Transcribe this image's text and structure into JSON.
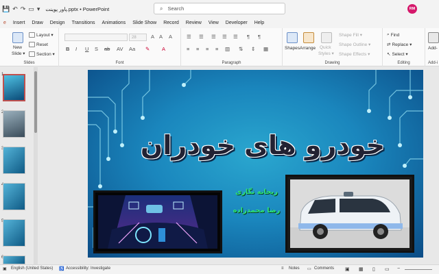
{
  "titlebar": {
    "doc_title": "پاور پوینت.pptx  •  PowerPoint",
    "search_placeholder": "Search",
    "avatar_initials": "RM",
    "qat": [
      "💾",
      "↶",
      "↷",
      "▭",
      "▾"
    ]
  },
  "tabs": [
    "e",
    "Insert",
    "Draw",
    "Design",
    "Transitions",
    "Animations",
    "Slide Show",
    "Record",
    "Review",
    "View",
    "Developer",
    "Help"
  ],
  "ribbon": {
    "slides": {
      "new_slide": "New",
      "new_slide_2": "Slide ▾",
      "layout": "Layout ▾",
      "reset": "Reset",
      "section": "Section ▾",
      "label": "Slides"
    },
    "font": {
      "font_size": "28",
      "label": "Font"
    },
    "paragraph": {
      "label": "Paragraph"
    },
    "drawing": {
      "shapes": "Shapes",
      "arrange": "Arrange",
      "quick_styles": "Quick",
      "quick_styles_2": "Styles ▾",
      "shape_fill": "Shape Fill ▾",
      "shape_outline": "Shape Outline ▾",
      "shape_effects": "Shape Effects ▾",
      "label": "Drawing"
    },
    "editing": {
      "find": "Find",
      "replace": "Replace ▾",
      "select": "Select ▾",
      "label": "Editing"
    },
    "addins": {
      "add": "Add-",
      "label": "Add-i"
    }
  },
  "thumbnails": [
    "1",
    "2",
    "3",
    "4",
    "5",
    "6"
  ],
  "slide": {
    "title": "خودرو های خودران",
    "author_1": "ریحانه نگاری",
    "author_2": "رضا محمدزاده"
  },
  "statusbar": {
    "language": "English (United States)",
    "accessibility": "Accessibility: Investigate",
    "notes": "Notes",
    "comments": "Comments"
  }
}
